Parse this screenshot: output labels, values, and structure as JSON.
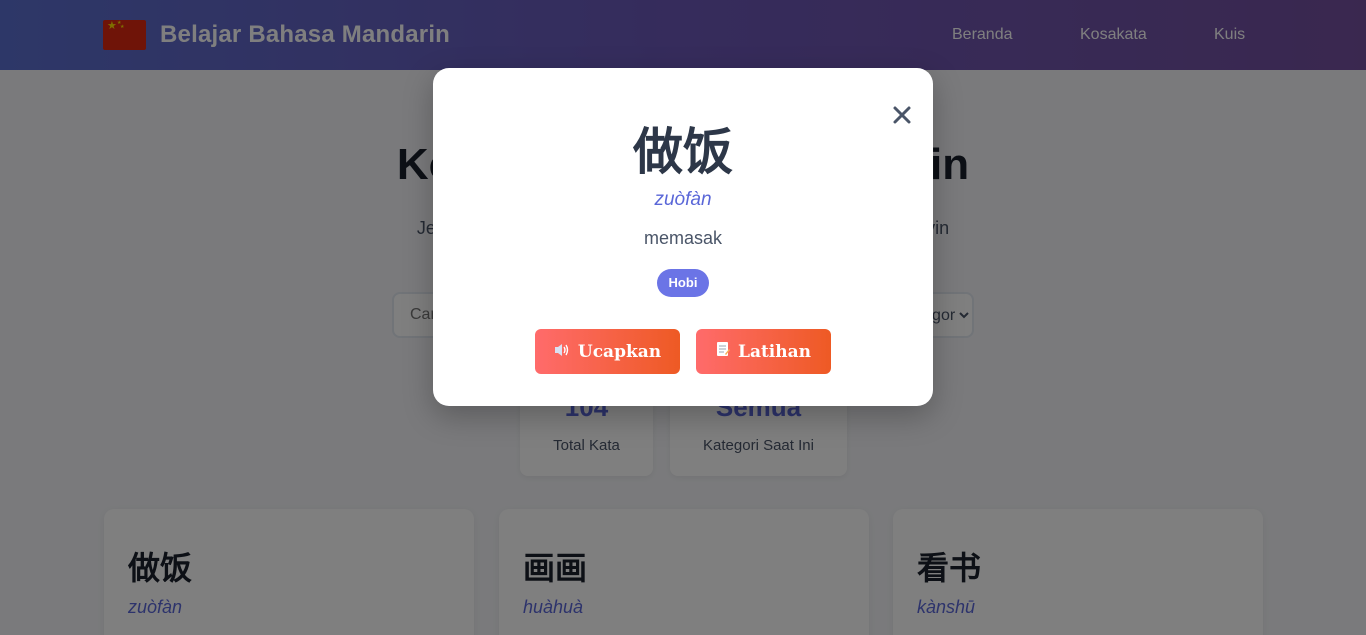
{
  "header": {
    "brand_title": "Belajar Bahasa Mandarin",
    "nav": [
      "Beranda",
      "Kosakata",
      "Kuis"
    ]
  },
  "hero": {
    "title": "Kosakata Bahasa Mandarin",
    "subtitle": "Jelajahi kosakata bahasa Mandarin lengkap dengan arti dan pinyin"
  },
  "filters": {
    "search_placeholder": "Cari kata...",
    "category_selected": "Semua Kategori"
  },
  "stats": [
    {
      "value": "104",
      "label": "Total Kata"
    },
    {
      "value": "Semua",
      "label": "Kategori Saat Ini"
    }
  ],
  "cards": [
    {
      "hanzi": "做饭",
      "pinyin": "zuòfàn"
    },
    {
      "hanzi": "画画",
      "pinyin": "huàhuà"
    },
    {
      "hanzi": "看书",
      "pinyin": "kànshū"
    }
  ],
  "modal": {
    "hanzi": "做饭",
    "pinyin": "zuòfàn",
    "meaning": "memasak",
    "category": "Hobi",
    "speak_label": "Ucapkan",
    "practice_label": "Latihan",
    "speak_icon": "speaker-icon",
    "practice_icon": "memo-icon",
    "close_icon": "close-icon"
  },
  "colors": {
    "header_start": "#5b6fd0",
    "header_end": "#74509f",
    "accent": "#5a67d8",
    "button_start": "#ff6b6b",
    "button_end": "#ee5a24",
    "badge": "#6b74e6"
  }
}
